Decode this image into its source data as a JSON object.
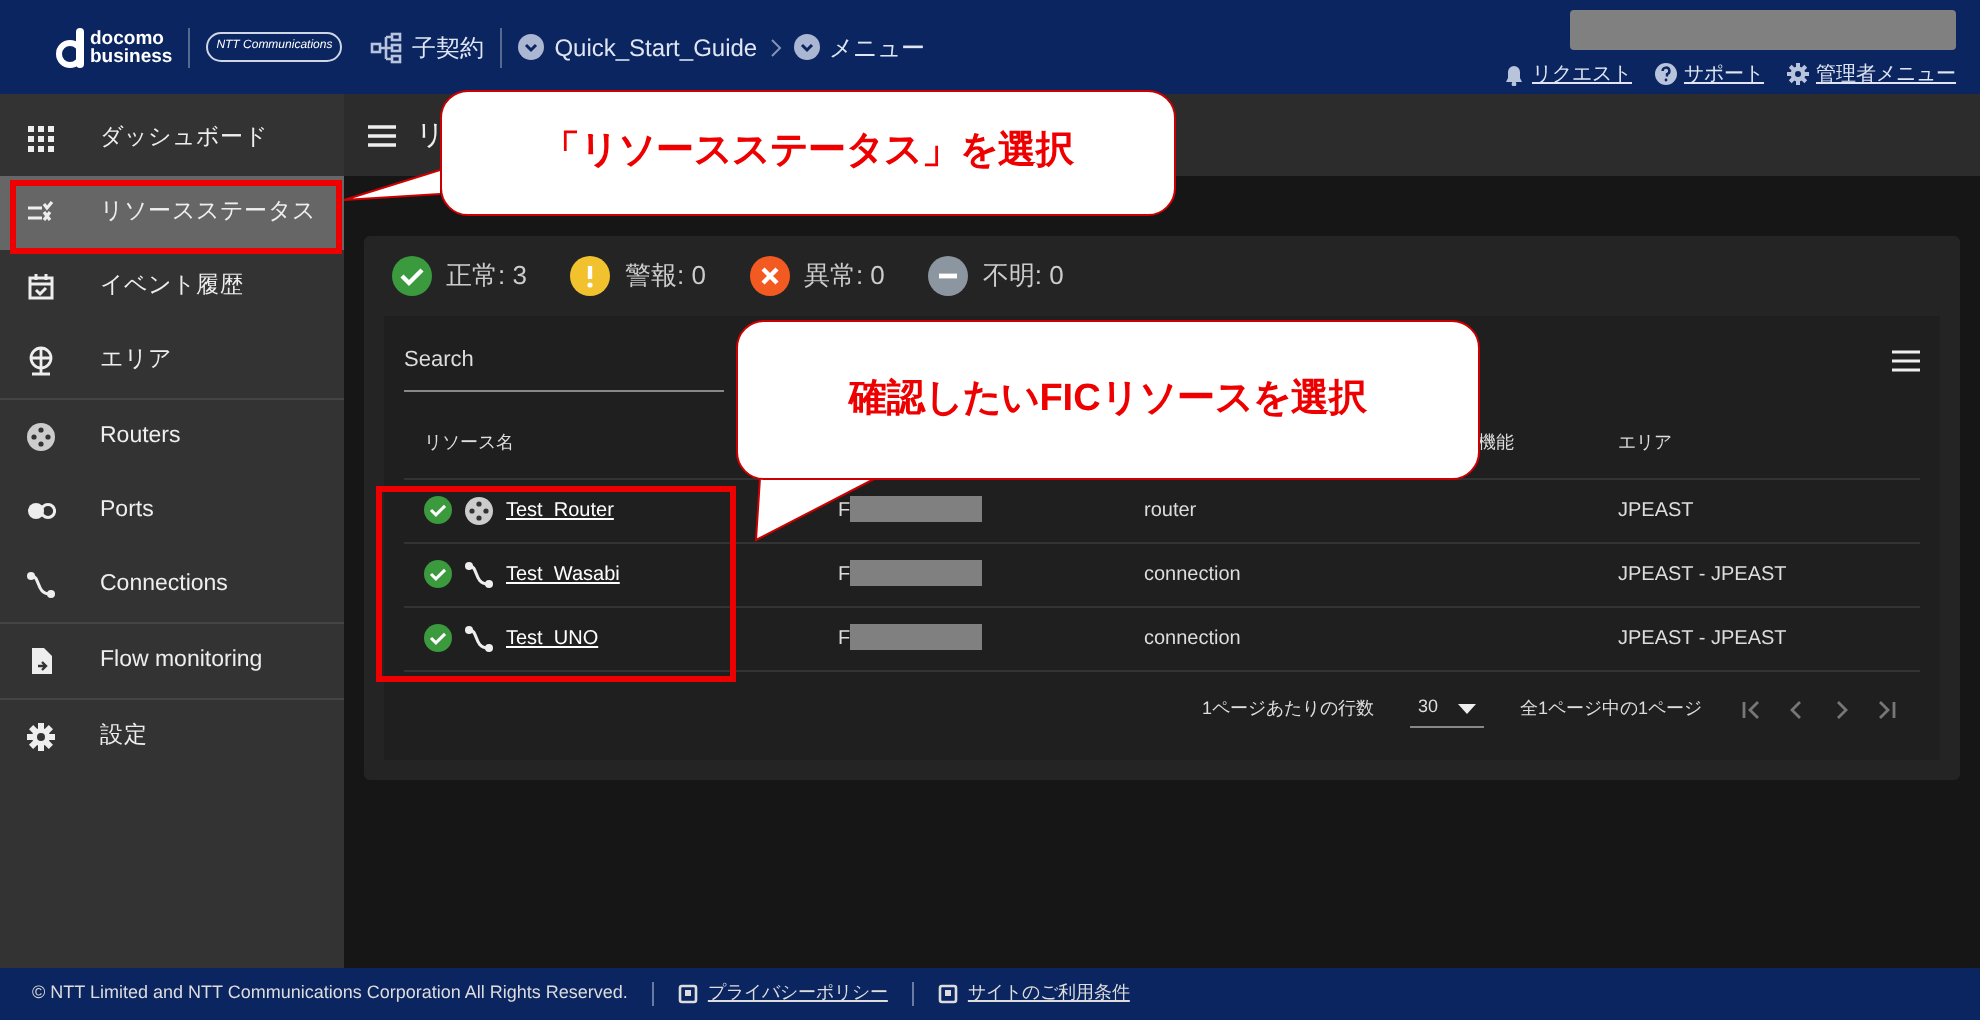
{
  "header": {
    "logo_line1": "docomo",
    "logo_line2": "business",
    "partner_logo": "NTT Communications",
    "contract": "子契約",
    "breadcrumb": [
      {
        "label": "Quick_Start_Guide"
      },
      {
        "label": "メニュー"
      }
    ],
    "links": [
      {
        "label": "リクエスト",
        "kind": "bell"
      },
      {
        "label": "サポート",
        "kind": "help"
      },
      {
        "label": "管理者メニュー",
        "kind": "gear"
      }
    ]
  },
  "sidebar": {
    "groups": [
      [
        {
          "label": "ダッシュボード",
          "kind": "grid",
          "selected": false
        },
        {
          "label": "リソースステータス",
          "kind": "status",
          "selected": true
        },
        {
          "label": "イベント履歴",
          "kind": "calendar",
          "selected": false
        },
        {
          "label": "エリア",
          "kind": "globe",
          "selected": false
        }
      ],
      [
        {
          "label": "Routers",
          "kind": "router",
          "selected": false
        },
        {
          "label": "Ports",
          "kind": "port",
          "selected": false
        },
        {
          "label": "Connections",
          "kind": "connection",
          "selected": false
        }
      ],
      [
        {
          "label": "Flow monitoring",
          "kind": "file",
          "selected": false
        }
      ],
      [
        {
          "label": "設定",
          "kind": "gear",
          "selected": false
        }
      ]
    ]
  },
  "toolbar": {
    "title": "リ"
  },
  "status": [
    {
      "label": "正常: 3",
      "kind": "ok"
    },
    {
      "label": "警報: 0",
      "kind": "warn"
    },
    {
      "label": "異常: 0",
      "kind": "error"
    },
    {
      "label": "不明: 0",
      "kind": "unknown"
    }
  ],
  "search": {
    "placeholder": "Search"
  },
  "table": {
    "columns": {
      "column_1": "リソース名",
      "column_4": "機能",
      "column_5": "エリア"
    },
    "rows": [
      {
        "normal": true,
        "kind": "router",
        "name": "Test_Router",
        "column_2": "F",
        "column_3": "router",
        "area": "JPEAST"
      },
      {
        "normal": true,
        "kind": "connection",
        "name": "Test_Wasabi",
        "column_2": "F",
        "column_3": "connection",
        "area": "JPEAST - JPEAST"
      },
      {
        "normal": true,
        "kind": "connection",
        "name": "Test_UNO",
        "column_2": "F",
        "column_3": "connection",
        "area": "JPEAST - JPEAST"
      }
    ]
  },
  "pagination": {
    "rows_label": "1ページあたりの行数",
    "rows_value": "30",
    "range": "全1ページ中の1ページ"
  },
  "footer": {
    "copyright": "© NTT Limited and NTT Communications Corporation All Rights Reserved.",
    "links": [
      {
        "label": "プライバシーポリシー"
      },
      {
        "label": "サイトのご利用条件"
      }
    ]
  },
  "callouts": [
    {
      "text": "「リソースステータス」を選択"
    },
    {
      "text": "確認したいFICリソースを選択"
    }
  ]
}
